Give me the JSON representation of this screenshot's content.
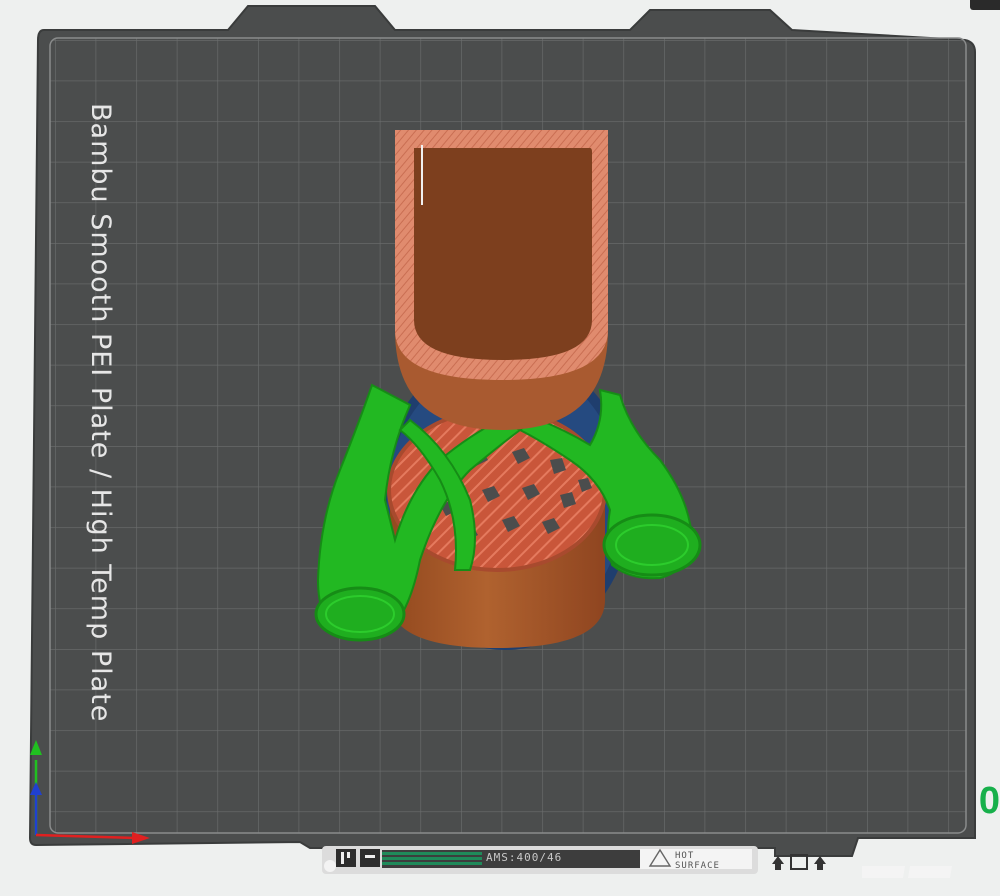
{
  "plate": {
    "label": "Bambu Smooth PEI Plate / High Temp Plate",
    "surface_label_line1": "HOT",
    "surface_label_line2": "SURFACE",
    "bar_text": "AMS:400/46"
  },
  "layer_indicator": "0",
  "colors": {
    "background": "#eef0ef",
    "plate": "#4b4d4d",
    "grid": "#6c6e6e",
    "model_wall": "#a95a30",
    "model_top": "#e08b6e",
    "support": "#1fb81f",
    "brim": "#1f3e6e",
    "axis_x": "#e02020",
    "axis_y": "#20c020",
    "axis_z": "#2040d0"
  },
  "icons": [
    "axis-gizmo-icon",
    "plate-logo-icon",
    "warning-triangle-icon",
    "plate-tool-icon"
  ]
}
